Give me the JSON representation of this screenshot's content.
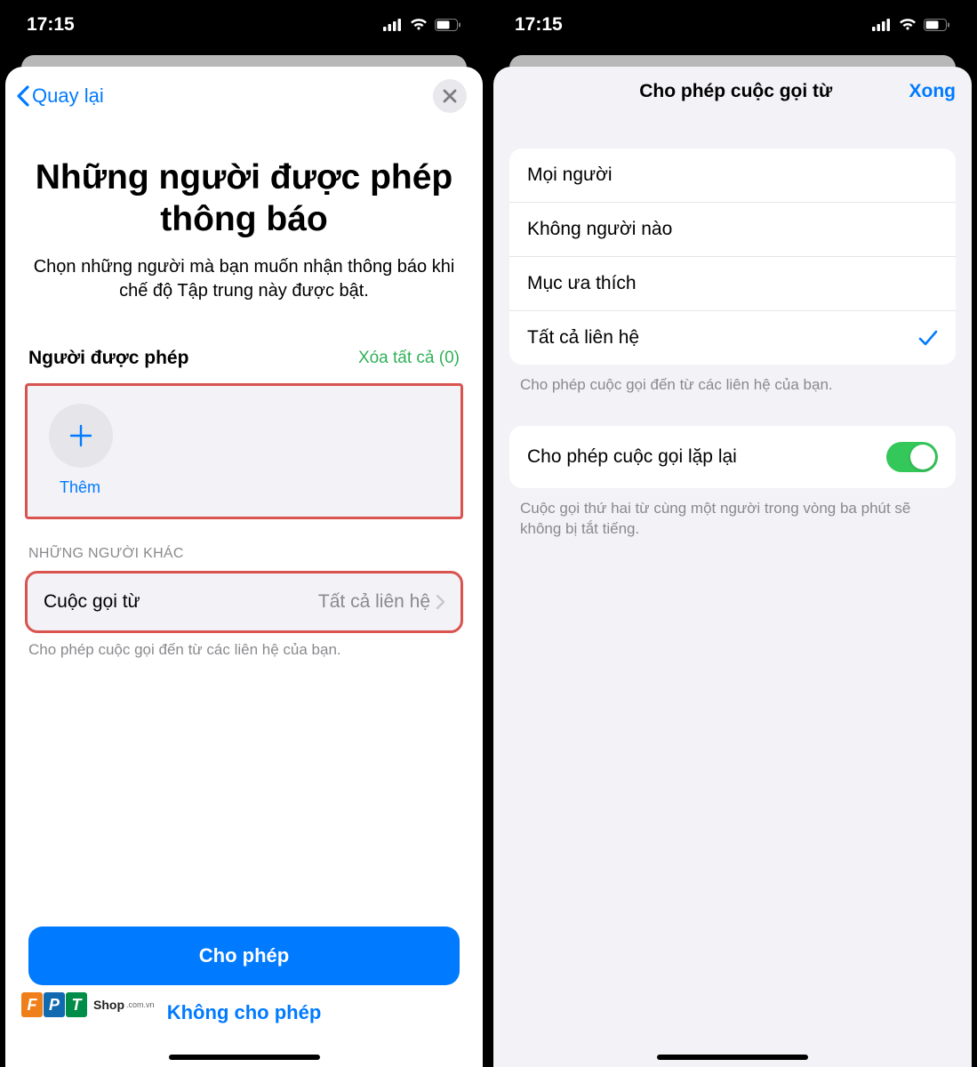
{
  "status": {
    "time": "17:15"
  },
  "left": {
    "back": "Quay lại",
    "title": "Những người được phép thông báo",
    "subtitle": "Chọn những người mà bạn muốn nhận thông báo khi chế độ Tập trung này được bật.",
    "allowed_heading": "Người được phép",
    "clear_all": "Xóa tất cả (0)",
    "add_label": "Thêm",
    "others_label": "NHỮNG NGƯỜI KHÁC",
    "calls_from_label": "Cuộc gọi từ",
    "calls_from_value": "Tất cả liên hệ",
    "calls_note": "Cho phép cuộc gọi đến từ các liên hệ của bạn.",
    "allow_btn": "Cho phép",
    "deny_btn": "Không cho phép"
  },
  "right": {
    "title": "Cho phép cuộc gọi từ",
    "done": "Xong",
    "options": [
      "Mọi người",
      "Không người nào",
      "Mục ưa thích",
      "Tất cả liên hệ"
    ],
    "selected_index": 3,
    "options_note": "Cho phép cuộc gọi đến từ các liên hệ của bạn.",
    "repeat_label": "Cho phép cuộc gọi lặp lại",
    "repeat_on": true,
    "repeat_note": "Cuộc gọi thứ hai từ cùng một người trong vòng ba phút sẽ không bị tắt tiếng."
  },
  "watermark": {
    "brand": "FPT",
    "text": "Shop",
    "suffix": ".com.vn"
  }
}
